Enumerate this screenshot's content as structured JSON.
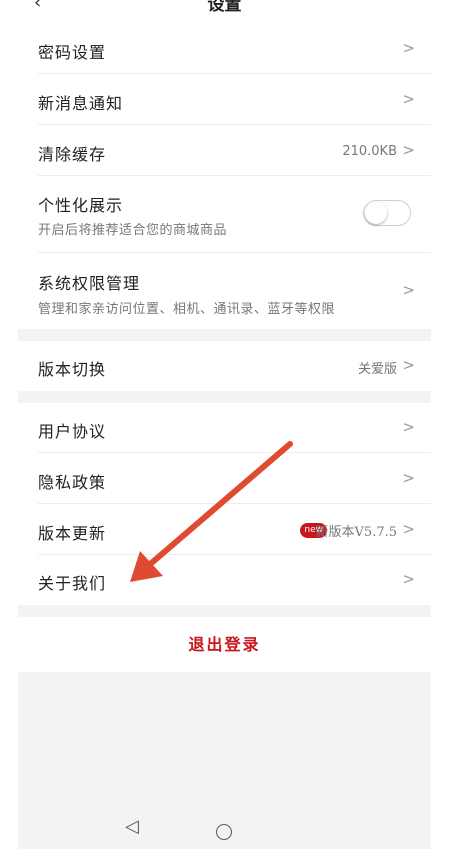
{
  "header": {
    "title": "设置",
    "back_icon": "chevron-left-icon"
  },
  "settings": {
    "password": {
      "title": "密码设置"
    },
    "notifications": {
      "title": "新消息通知"
    },
    "cache": {
      "title": "清除缓存",
      "value": "210.0KB"
    },
    "personalization": {
      "title": "个性化展示",
      "subtitle": "开启后将推荐适合您的商城商品",
      "toggle_on": false
    },
    "permissions": {
      "title": "系统权限管理",
      "subtitle": "管理和家亲访问位置、相机、通讯录、蓝牙等权限"
    },
    "version_switch": {
      "title": "版本切换",
      "value": "关爱版"
    },
    "user_agreement": {
      "title": "用户协议"
    },
    "privacy": {
      "title": "隐私政策"
    },
    "update": {
      "title": "版本更新",
      "badge": "new",
      "value": "新版本V5.7.5"
    },
    "about": {
      "title": "关于我们"
    }
  },
  "logout": {
    "label": "退出登录"
  },
  "navbar": {
    "back_icon": "triangle-back-icon",
    "home_icon": "circle-home-icon"
  },
  "annotation": {
    "arrow_color": "#e04a33"
  },
  "colors": {
    "accent": "#c8161d",
    "background": "#f3f3f3"
  }
}
